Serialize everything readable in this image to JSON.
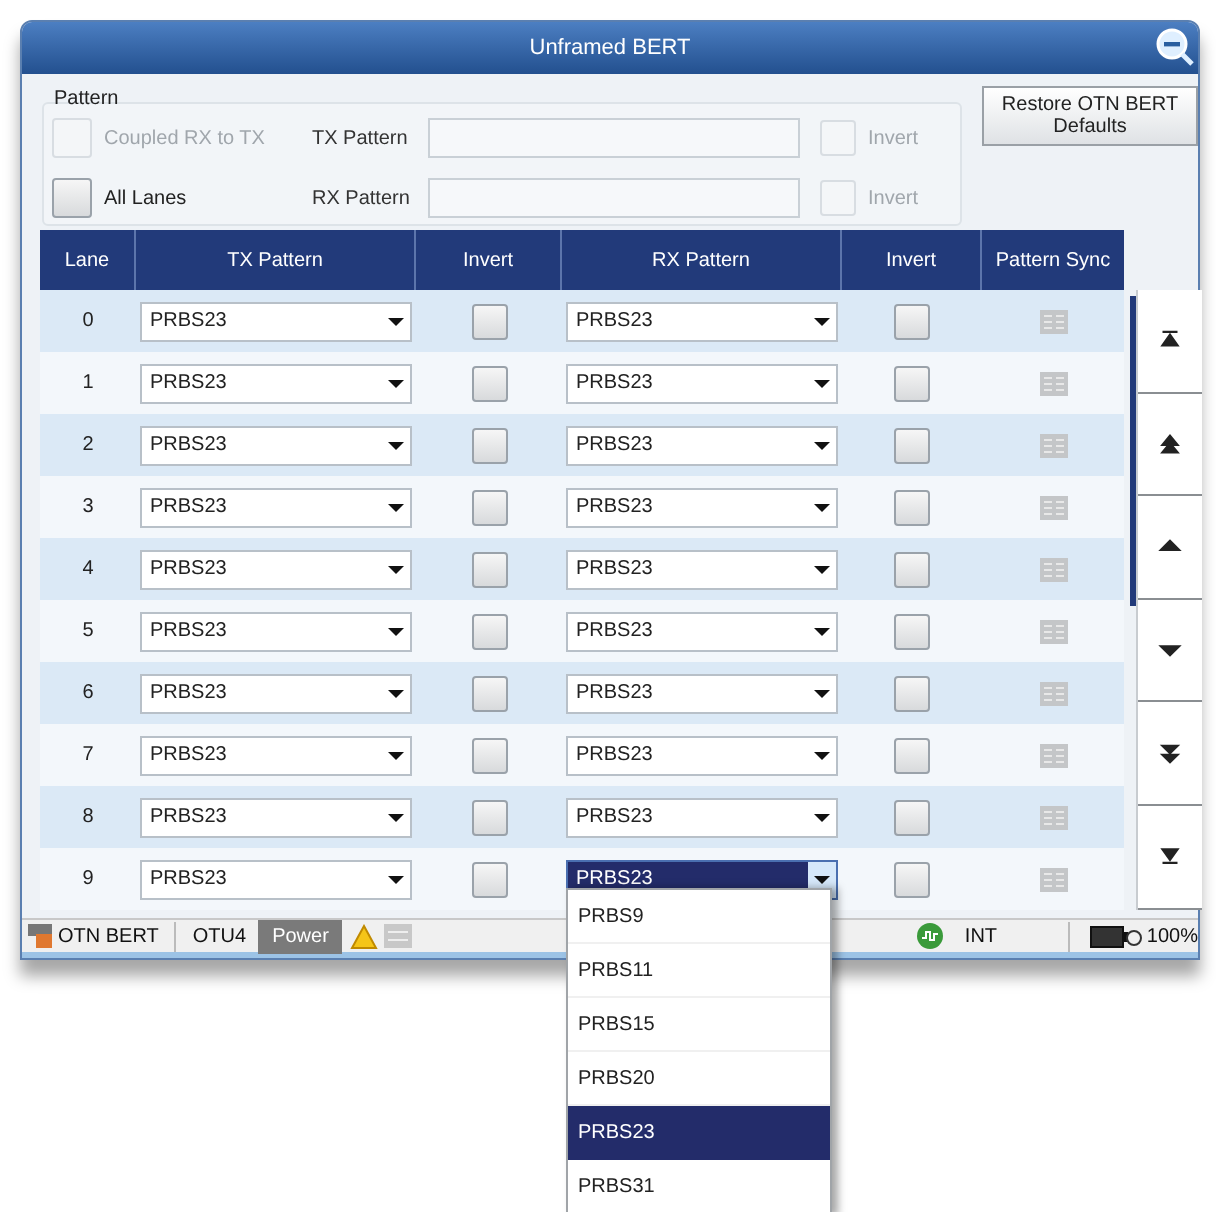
{
  "window": {
    "title": "Unframed BERT"
  },
  "pattern_group": {
    "title": "Pattern",
    "coupled": {
      "label": "Coupled RX to TX",
      "checked": false,
      "disabled": true
    },
    "all_lanes": {
      "label": "All Lanes",
      "checked": false,
      "disabled": false
    },
    "tx_pattern": {
      "label": "TX Pattern",
      "disabled": true
    },
    "rx_pattern": {
      "label": "RX Pattern",
      "disabled": true
    },
    "tx_invert": {
      "label": "Invert",
      "checked": false,
      "disabled": true
    },
    "rx_invert": {
      "label": "Invert",
      "checked": false,
      "disabled": true
    }
  },
  "restore_button": "Restore OTN BERT Defaults",
  "table": {
    "columns": [
      "Lane",
      "TX Pattern",
      "Invert",
      "RX Pattern",
      "Invert",
      "Pattern Sync"
    ],
    "rows": [
      {
        "lane": "0",
        "tx_pattern": "PRBS23",
        "tx_invert": false,
        "rx_pattern": "PRBS23",
        "rx_invert": false,
        "rx_open": false
      },
      {
        "lane": "1",
        "tx_pattern": "PRBS23",
        "tx_invert": false,
        "rx_pattern": "PRBS23",
        "rx_invert": false,
        "rx_open": false
      },
      {
        "lane": "2",
        "tx_pattern": "PRBS23",
        "tx_invert": false,
        "rx_pattern": "PRBS23",
        "rx_invert": false,
        "rx_open": false
      },
      {
        "lane": "3",
        "tx_pattern": "PRBS23",
        "tx_invert": false,
        "rx_pattern": "PRBS23",
        "rx_invert": false,
        "rx_open": false
      },
      {
        "lane": "4",
        "tx_pattern": "PRBS23",
        "tx_invert": false,
        "rx_pattern": "PRBS23",
        "rx_invert": false,
        "rx_open": false
      },
      {
        "lane": "5",
        "tx_pattern": "PRBS23",
        "tx_invert": false,
        "rx_pattern": "PRBS23",
        "rx_invert": false,
        "rx_open": false
      },
      {
        "lane": "6",
        "tx_pattern": "PRBS23",
        "tx_invert": false,
        "rx_pattern": "PRBS23",
        "rx_invert": false,
        "rx_open": false
      },
      {
        "lane": "7",
        "tx_pattern": "PRBS23",
        "tx_invert": false,
        "rx_pattern": "PRBS23",
        "rx_invert": false,
        "rx_open": false
      },
      {
        "lane": "8",
        "tx_pattern": "PRBS23",
        "tx_invert": false,
        "rx_pattern": "PRBS23",
        "rx_invert": false,
        "rx_open": false
      },
      {
        "lane": "9",
        "tx_pattern": "PRBS23",
        "tx_invert": false,
        "rx_pattern": "PRBS23",
        "rx_invert": false,
        "rx_open": true
      }
    ]
  },
  "dropdown": {
    "items": [
      {
        "label": "PRBS9",
        "selected": false
      },
      {
        "label": "PRBS11",
        "selected": false
      },
      {
        "label": "PRBS15",
        "selected": false
      },
      {
        "label": "PRBS20",
        "selected": false
      },
      {
        "label": "PRBS23",
        "selected": true
      },
      {
        "label": "PRBS31",
        "selected": false
      }
    ]
  },
  "status_bar": {
    "app": "OTN BERT",
    "interface": "OTU4",
    "power": "Power",
    "clock": "INT",
    "battery": "100%"
  }
}
